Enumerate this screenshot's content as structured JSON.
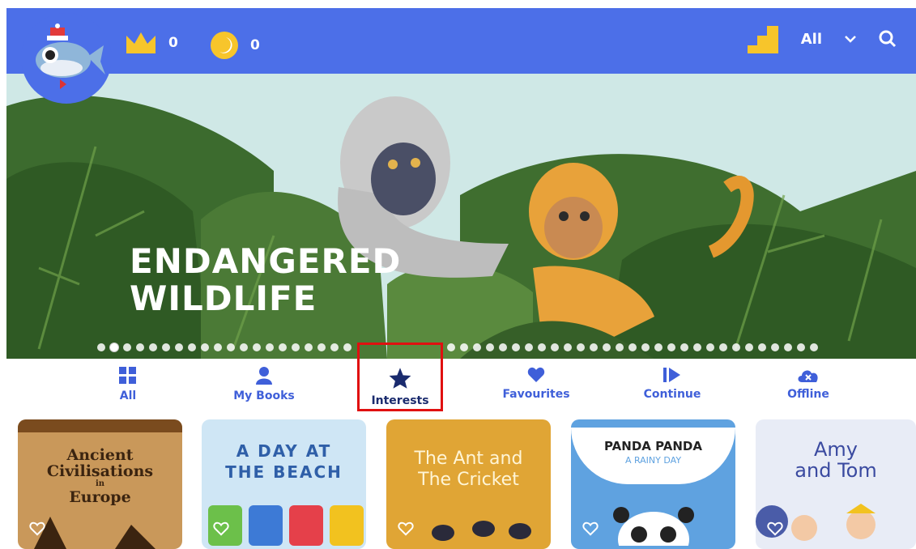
{
  "header": {
    "crown_count": "0",
    "coin_count": "0",
    "filter_label": "All",
    "icons": [
      "crown-icon",
      "coin-icon",
      "stairs-icon",
      "chevron-down-icon",
      "search-icon"
    ]
  },
  "hero": {
    "title_line1": "ENDANGERED",
    "title_line2": "WILDLIFE"
  },
  "tabs": [
    {
      "label": "All",
      "icon": "grid-icon"
    },
    {
      "label": "My Books",
      "icon": "person-icon"
    },
    {
      "label": "Interests",
      "icon": "star-icon"
    },
    {
      "label": "Favourites",
      "icon": "heart-icon"
    },
    {
      "label": "Continue",
      "icon": "play-icon"
    },
    {
      "label": "Offline",
      "icon": "cloud-icon"
    }
  ],
  "books": [
    {
      "line1": "Ancient",
      "line2": "Civilisations",
      "line3": "in",
      "line4": "Europe"
    },
    {
      "line1": "A DAY AT",
      "line2": "THE BEACH"
    },
    {
      "line1": "The Ant and",
      "line2": "The Cricket"
    },
    {
      "line1": "PANDA PANDA",
      "line2": "A RAINY DAY"
    },
    {
      "line1": "Amy",
      "line2": "and Tom"
    }
  ],
  "colors": {
    "brand_blue": "#4c6fe8",
    "tab_blue": "#3f5fd9",
    "selected_tab": "#1a2b6e",
    "highlight_red": "#e01010",
    "crown_yellow": "#f7c52b"
  }
}
